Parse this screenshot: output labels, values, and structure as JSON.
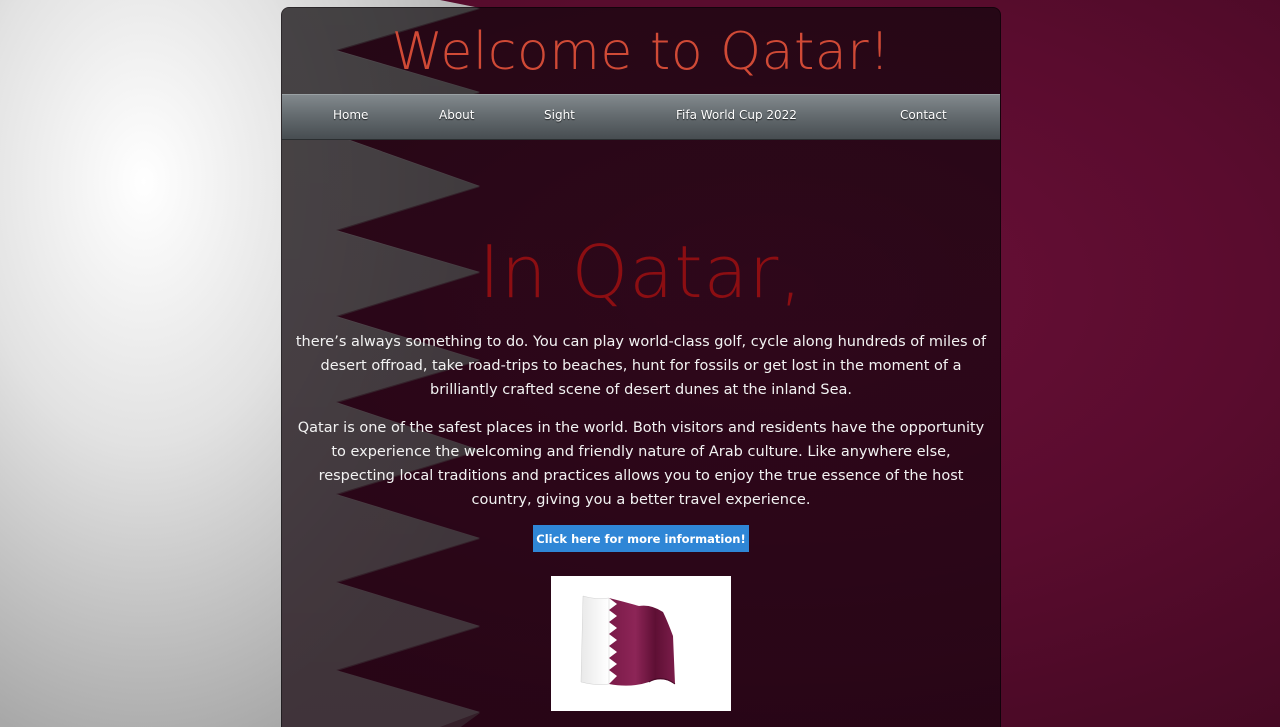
{
  "header": {
    "title": "Welcome to Qatar!"
  },
  "nav": {
    "items": [
      {
        "label": "Home"
      },
      {
        "label": "About"
      },
      {
        "label": "Sight"
      },
      {
        "label": "Fifa World Cup 2022"
      },
      {
        "label": "Contact"
      }
    ]
  },
  "main": {
    "heading": "In Qatar,",
    "paragraph1": "there’s always something to do. You can play world-class golf, cycle along hundreds of miles of desert offroad, take road-trips to beaches, hunt for fossils or get lost in the moment of a brilliantly crafted scene of desert dunes at the inland Sea.",
    "paragraph2": "Qatar is one of the safest places in the world. Both visitors and residents have the opportunity to experience the welcoming and friendly nature of Arab culture. Like anywhere else, respecting local traditions and practices allows you to enjoy the true essence of the host country, giving you a better travel experience.",
    "cta_label": "Click here for more information!",
    "flag_image": "waving-qatar-flag"
  },
  "colors": {
    "title": "#d04a36",
    "heading": "#8c0e12",
    "maroon": "#5a0c2e",
    "button": "#2f86d6"
  }
}
